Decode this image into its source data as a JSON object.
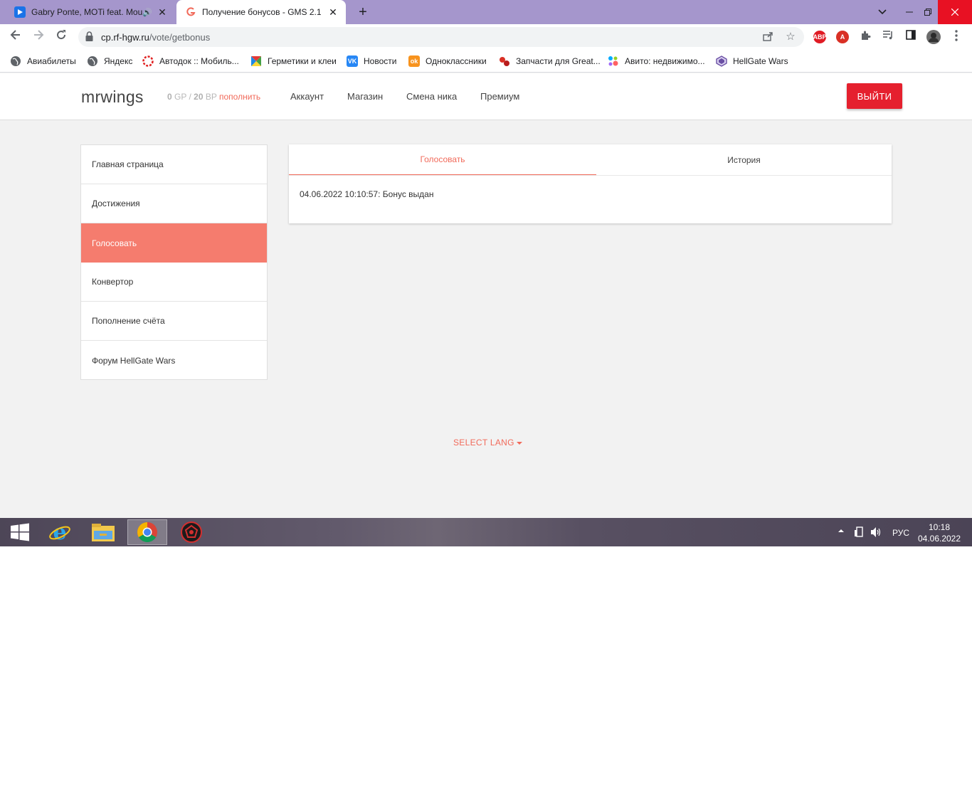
{
  "browser": {
    "tabs": [
      {
        "title": "Gabry Ponte, MOTi feat. Mou",
        "favicon": "play-icon",
        "favicon_color": "#1a73e8"
      },
      {
        "title": "Получение бонусов - GMS 2.1",
        "favicon": "gms-logo-icon",
        "favicon_color": "#f16a5a"
      }
    ],
    "new_tab": "+",
    "url_host": "cp.rf-hgw.ru",
    "url_path": "/vote/getbonus",
    "extensions": [
      {
        "label": "ABP",
        "color": "#e01b24"
      },
      {
        "label": "A",
        "color": "#d93025"
      }
    ]
  },
  "bookmarks": [
    {
      "label": "Авиабилеты",
      "icon": "globe-icon",
      "color": "#5f6368"
    },
    {
      "label": "Яндекс",
      "icon": "globe-icon",
      "color": "#5f6368"
    },
    {
      "label": "Автодок :: Мобиль...",
      "icon": "autodoc-icon",
      "color": "#e02020"
    },
    {
      "label": "Герметики и клеи",
      "icon": "colorful-square-icon",
      "color": "#34a853"
    },
    {
      "label": "Новости",
      "icon": "vk-icon",
      "color": "#2787f5"
    },
    {
      "label": "Одноклассники",
      "icon": "ok-icon",
      "color": "#f7931e"
    },
    {
      "label": "Запчасти для Great...",
      "icon": "parts-icon",
      "color": "#d93025"
    },
    {
      "label": "Авито: недвижимо...",
      "icon": "avito-icon",
      "color": "#00aaff"
    },
    {
      "label": "HellGate Wars",
      "icon": "hellgate-icon",
      "color": "#6a4fa3"
    }
  ],
  "header": {
    "username": "mrwings",
    "gp_value": "0",
    "gp_unit": " GP / ",
    "bp_value": "20",
    "bp_unit": " BP ",
    "topup_label": "пополнить",
    "nav": [
      "Аккаунт",
      "Магазин",
      "Смена ника",
      "Премиум"
    ],
    "logout_label": "ВЫЙТИ",
    "accent": "#e5202e"
  },
  "sidebar": {
    "items": [
      {
        "label": "Главная страница",
        "active": false
      },
      {
        "label": "Достижения",
        "active": false
      },
      {
        "label": "Голосовать",
        "active": true
      },
      {
        "label": "Конвертор",
        "active": false
      },
      {
        "label": "Пополнение счёта",
        "active": false
      },
      {
        "label": "Форум HellGate Wars",
        "active": false
      }
    ],
    "active_color": "#f57c6e"
  },
  "main": {
    "tabs": [
      "Голосовать",
      "История"
    ],
    "active_tab": "Голосовать",
    "entry": "04.06.2022 10:10:57: Бонус выдан"
  },
  "footer": {
    "select_lang": "SELECT LANG"
  },
  "taskbar": {
    "apps": [
      "windows-start-icon",
      "internet-explorer-icon",
      "file-explorer-icon",
      "chrome-icon",
      "game-launcher-icon"
    ],
    "language": "РУС",
    "time": "10:18",
    "date": "04.06.2022"
  }
}
